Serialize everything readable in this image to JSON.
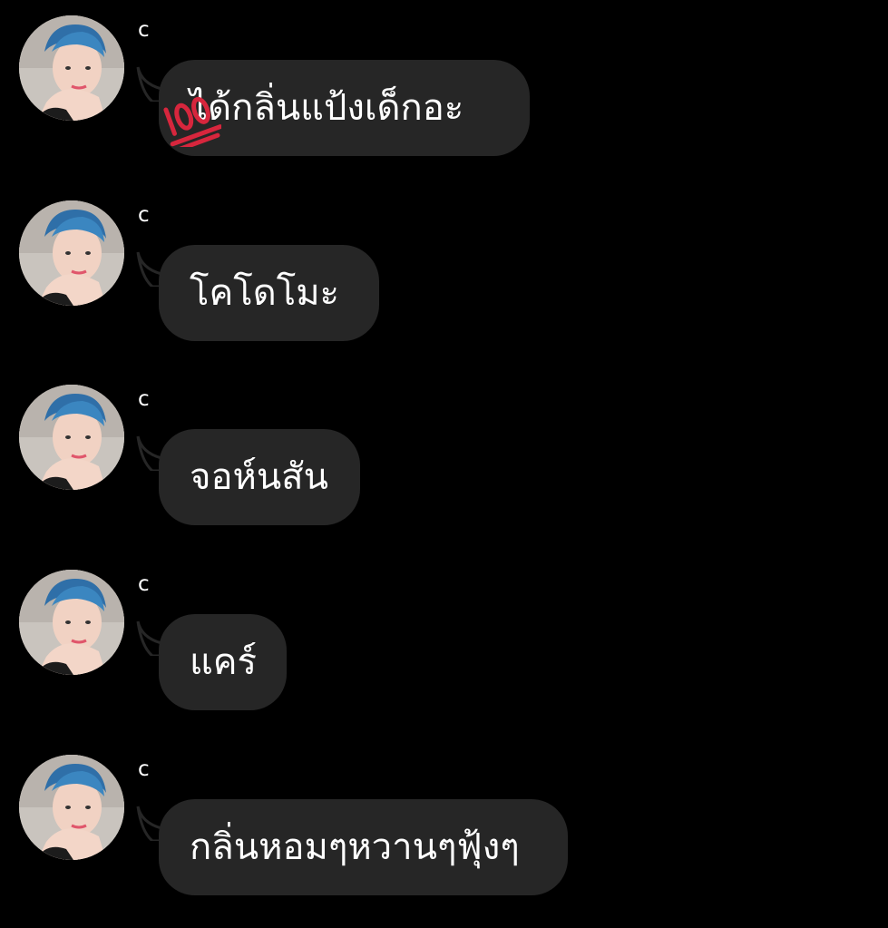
{
  "messages": [
    {
      "sender": "c",
      "text": "ได้กลิ่นแป้งเด็กอะ",
      "sticker": "hundred-points-emoji"
    },
    {
      "sender": "c",
      "text": "โคโดโมะ"
    },
    {
      "sender": "c",
      "text": "จอห์นสัน"
    },
    {
      "sender": "c",
      "text": "แคร์"
    },
    {
      "sender": "c",
      "text": "กลิ่นหอมๆหวานๆฟุ้งๆ"
    }
  ],
  "colors": {
    "background": "#000000",
    "bubble": "#262626",
    "text": "#ffffff",
    "emoji": "#d7263d"
  },
  "icons": {
    "avatar": "profile-photo",
    "sticker": "hundred-points-emoji"
  }
}
